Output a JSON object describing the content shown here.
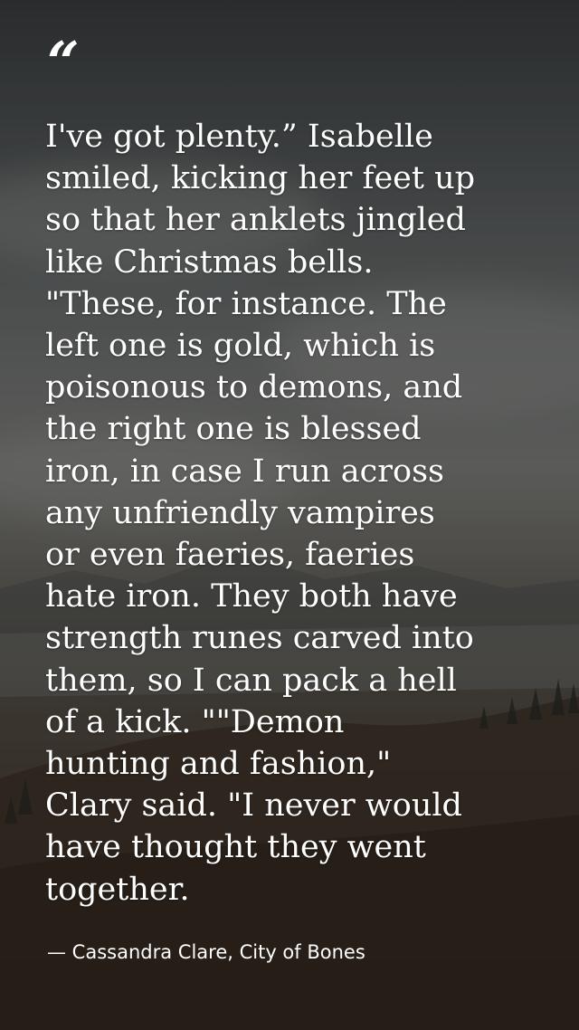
{
  "quote": {
    "mark": "“",
    "lines": [
      "I've got plenty.” Isabelle",
      "smiled, kicking her feet up",
      "so that her anklets jingled",
      "like Christmas bells.",
      "\"These, for instance. The",
      "left one is gold, which is",
      "poisonous to demons, and",
      "the right one is blessed",
      "iron, in case I run across",
      "any unfriendly vampires",
      "or even faeries, faeries",
      "hate iron. They both have",
      "strength runes carved into",
      "them, so I can pack a hell",
      "of a kick. \"\"Demon",
      "hunting and fashion,\"",
      "Clary said. \"I never would",
      "have thought they went",
      "together."
    ],
    "attribution": "— Cassandra Clare, City of Bones"
  }
}
